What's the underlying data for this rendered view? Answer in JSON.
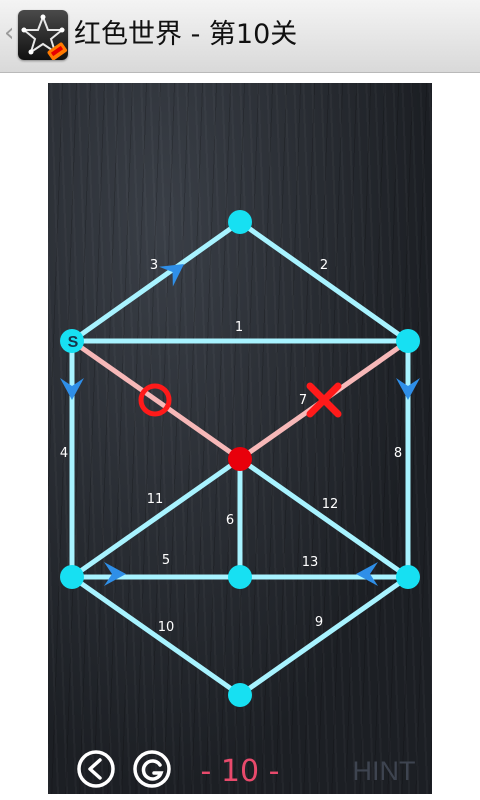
{
  "app": {
    "title": "红色世界 - 第10关",
    "icon": "star-puzzle-app-icon",
    "back_icon": "chevron-left-icon"
  },
  "game": {
    "start_label": "S",
    "level_label": "- 10 -",
    "hint_label": "HINT",
    "colors": {
      "edge": "#a8f3ff",
      "edge_drawn": "#f7b8b8",
      "node": "#17e0f2",
      "active_node": "#e8000b",
      "arrow": "#2f8fe8",
      "marker": "#ff1a1a"
    },
    "nodes": [
      {
        "id": "top",
        "kind": "normal"
      },
      {
        "id": "upper-left",
        "kind": "start"
      },
      {
        "id": "upper-right",
        "kind": "normal"
      },
      {
        "id": "center",
        "kind": "active"
      },
      {
        "id": "lower-left",
        "kind": "normal"
      },
      {
        "id": "lower-middle",
        "kind": "normal"
      },
      {
        "id": "lower-right",
        "kind": "normal"
      },
      {
        "id": "bottom",
        "kind": "normal"
      }
    ],
    "edges": [
      {
        "label": "1",
        "from": "upper-left",
        "to": "upper-right",
        "state": "open"
      },
      {
        "label": "2",
        "from": "top",
        "to": "upper-right",
        "state": "open"
      },
      {
        "label": "3",
        "from": "upper-left",
        "to": "top",
        "state": "open",
        "arrow": true
      },
      {
        "label": "4",
        "from": "upper-left",
        "to": "lower-left",
        "state": "open",
        "arrow": true
      },
      {
        "label": "5",
        "from": "lower-left",
        "to": "lower-middle",
        "state": "open",
        "arrow": true
      },
      {
        "label": "6",
        "from": "center",
        "to": "lower-middle",
        "state": "open"
      },
      {
        "label": "7",
        "from": "center",
        "to": "upper-right",
        "state": "drawn",
        "marker": "cross"
      },
      {
        "label": "",
        "from": "upper-left",
        "to": "center",
        "state": "drawn",
        "marker": "circle"
      },
      {
        "label": "8",
        "from": "upper-right",
        "to": "lower-right",
        "state": "open",
        "arrow": true
      },
      {
        "label": "9",
        "from": "lower-right",
        "to": "bottom",
        "state": "open"
      },
      {
        "label": "10",
        "from": "lower-left",
        "to": "bottom",
        "state": "open"
      },
      {
        "label": "11",
        "from": "center",
        "to": "lower-left",
        "state": "open"
      },
      {
        "label": "12",
        "from": "center",
        "to": "lower-right",
        "state": "open"
      },
      {
        "label": "13",
        "from": "lower-middle",
        "to": "lower-right",
        "state": "open",
        "arrow": true
      }
    ],
    "controls": {
      "back_icon": "back-arrow-circle-icon",
      "restart_icon": "restart-circle-icon"
    }
  }
}
